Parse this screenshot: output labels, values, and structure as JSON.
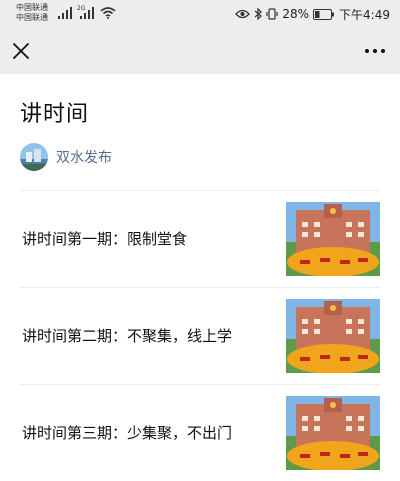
{
  "status_bar": {
    "carrier_1": "中国联通",
    "carrier_2": "中国联通",
    "network_1": "",
    "network_2": "2G",
    "battery": "28%",
    "time": "下午4:49"
  },
  "nav": {
    "close_icon": "close-icon",
    "more_icon": "more-icon"
  },
  "page": {
    "title": "讲时间",
    "publisher": "双水发布"
  },
  "articles": [
    {
      "title": "讲时间第一期：限制堂食"
    },
    {
      "title": "讲时间第二期：不聚集，线上学"
    },
    {
      "title": "讲时间第三期：少集聚，不出门"
    }
  ],
  "colors": {
    "status_bg": "#ededed",
    "link": "#576b95",
    "text": "#111111"
  }
}
